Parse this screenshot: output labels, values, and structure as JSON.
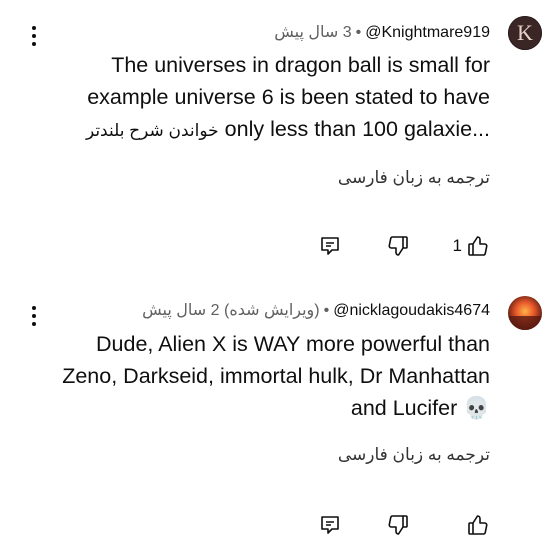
{
  "comments": [
    {
      "handle": "@Knightmare919",
      "time": "3 سال پیش",
      "edited": "",
      "lines": [
        "The universes in dragon ball is small for",
        "example universe 6 is been stated to have",
        "only less than 100 galaxie..."
      ],
      "read_more": "خواندن شرح بلندتر",
      "translate": "ترجمه به زبان فارسی",
      "likes": "1",
      "avatar_letter": "K"
    },
    {
      "handle": "@nicklagoudakis4674",
      "time": "2 سال پیش",
      "edited": "(ویرایش شده)",
      "lines": [
        "Dude, Alien X is WAY more powerful than",
        "Zeno, Darkseid, immortal hulk, Dr Manhattan",
        "and Lucifer 💀"
      ],
      "translate": "ترجمه به زبان فارسی",
      "likes": ""
    }
  ]
}
